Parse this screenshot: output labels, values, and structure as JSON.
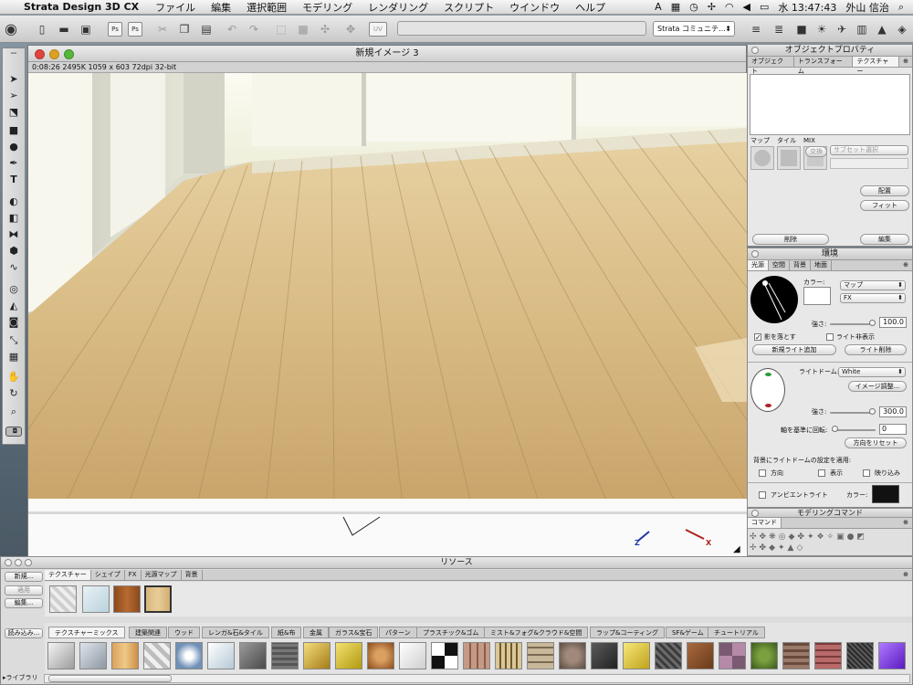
{
  "menubar": {
    "app": "Strata Design 3D CX",
    "items": [
      "ファイル",
      "編集",
      "選択範囲",
      "モデリング",
      "レンダリング",
      "スクリプト",
      "ウインドウ",
      "ヘルプ"
    ],
    "clock": "水 13:47:43",
    "user": "外山 信治"
  },
  "toolbar": {
    "community": "Strata コミュニテ…"
  },
  "document": {
    "title": "新規イメージ 3",
    "info": "0:08:26  2495K  1059 x 603  72dpi  32-bit"
  },
  "objprops": {
    "title": "オブジェクトプロパティ",
    "tabs": [
      "オブジェクト",
      "トランスフォーム",
      "テクスチャー"
    ],
    "map": "マップ",
    "tile": "タイル",
    "mix": "MIX",
    "swap": "交換",
    "subset": "サブセット選択",
    "arrange": "配置",
    "fit": "フィット",
    "delete": "削除",
    "edit": "編集"
  },
  "env": {
    "title": "環境",
    "tabs": [
      "光源",
      "空間",
      "背景",
      "地面"
    ],
    "color_label": "カラー:",
    "map_select": "マップ",
    "fx_select": "FX",
    "strength_label": "強さ:",
    "strength1": "100.0",
    "cast_shadow": "影を落とす",
    "hide_light": "ライト非表示",
    "add_light": "新規ライト追加",
    "delete_light": "ライト削除",
    "dome_label": "ライトドーム:",
    "dome_value": "White",
    "image_adjust": "イメージ調整...",
    "strength2": "300.0",
    "rotate_label": "軸を基準に回転:",
    "rotate_value": "0",
    "reset_dir": "方向をリセット",
    "apply_label": "背景にライトドームの設定を適用:",
    "direction": "方向",
    "display": "表示",
    "reflection": "映り込み",
    "ambient": "アンビエントライト",
    "ambient_color": "カラー:"
  },
  "modeling": {
    "title": "モデリングコマンド",
    "tab": "コマンド"
  },
  "resources": {
    "title": "リソース",
    "new": "新規...",
    "apply": "適用",
    "edit": "編集...",
    "load": "読み込み...",
    "tabs": [
      "テクスチャー",
      "シェイプ",
      "FX",
      "光源マップ",
      "背景"
    ],
    "library": "▸ライブラリ",
    "categories": [
      "テクスチャーミックス",
      "建築関連",
      "ウッド",
      "レンガ&石&タイル",
      "紙&布",
      "金属",
      "ガラス&宝石",
      "パターン",
      "プラスチック&ゴム",
      "ミスト&フォグ&クラウド&空間",
      "ラップ&コーティング",
      "SF&ゲーム",
      "チュートリアル"
    ]
  },
  "axes": {
    "z": "Z",
    "x": "X"
  }
}
